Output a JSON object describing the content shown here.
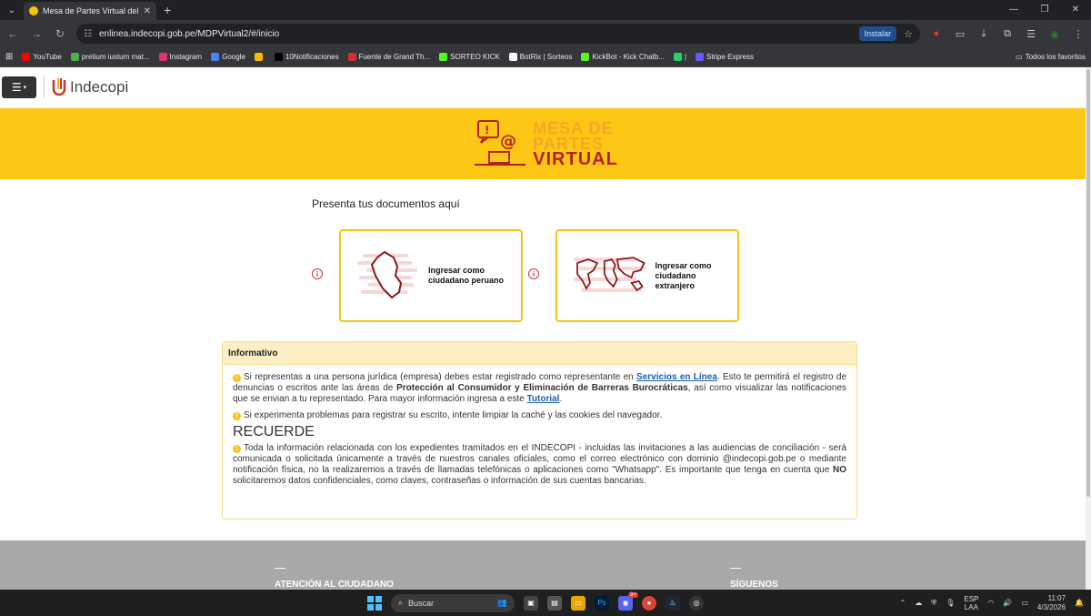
{
  "browser": {
    "tab_title": "Mesa de Partes Virtual del Inde",
    "url": "enlinea.indecopi.gob.pe/MDPVirtual2/#/inicio",
    "install_label": "Instalar",
    "bookmarks": [
      {
        "label": "YouTube",
        "color": "#ff0000"
      },
      {
        "label": "pretium iustum mat...",
        "color": "#4caf50"
      },
      {
        "label": "Instagram",
        "color": "#e1306c"
      },
      {
        "label": "Google",
        "color": "#4285f4"
      },
      {
        "label": "",
        "color": "#fbbc05"
      },
      {
        "label": "10Notificaciones",
        "color": "#000000"
      },
      {
        "label": "Fuente de Grand Th...",
        "color": "#d32f2f"
      },
      {
        "label": "SORTEO KICK",
        "color": "#53fc18"
      },
      {
        "label": "BotRix | Sorteos",
        "color": "#ffffff"
      },
      {
        "label": "KickBot - Kick Chatb...",
        "color": "#53fc18"
      },
      {
        "label": "|",
        "color": "#25d366"
      },
      {
        "label": "Stripe Express",
        "color": "#635bff"
      }
    ],
    "all_bookmarks_label": "Todos los favoritos"
  },
  "site": {
    "logo_text": "Indecopi",
    "banner": {
      "line1": "MESA DE",
      "line2": "PARTES",
      "line3": "VIRTUAL"
    },
    "presenta": "Presenta tus documentos aquí",
    "card_peru": {
      "line1": "Ingresar como",
      "line2": "ciudadano peruano"
    },
    "card_ext": {
      "line1": "Ingresar como",
      "line2": "ciudadano extranjero"
    },
    "informativo": {
      "title": "Informativo",
      "p1_a": "Si representas a una persona jurídica (empresa) debes estar registrado como representante en ",
      "p1_link1": "Servicios en Línea",
      "p1_b": ". Esto te permitirá el registro de denuncias o escritos ante las áreas de ",
      "p1_bold": "Protección al Consumidor y Eliminación de Barreras Burocráticas",
      "p1_c": ", así como visualizar las notificaciones que se envian a tu representado. Para mayor información ingresa a este ",
      "p1_link2": "Tutorial",
      "p1_d": ".",
      "p2": "Si experimenta problemas para registrar su escrito, intente limpiar la caché y las cookies del navegador.",
      "recuerde": "RECUERDE",
      "p3_a": "Toda la información relacionada con los expedientes tramitados en el INDECOPI - incluidas las invitaciones a las audiencias de conciliación - será comunicada o solicitada únicamente a través de nuestros canales oficiales, como el correo electrónico con dominio @indecopi.gob.pe o mediante notificación física, no la realizaremos a través de llamadas telefónicas o aplicaciones como \"Whatsapp\". Es importante que tenga en cuenta que ",
      "p3_bold": "NO",
      "p3_b": " solicitaremos datos confidenciales, como claves, contraseñas o información de sus cuentas bancarias."
    },
    "footer": {
      "col1": "ATENCIÓN AL CIUDADANO",
      "col2": "SÍGUENOS"
    }
  },
  "taskbar": {
    "search_label": "Buscar",
    "lang_1": "ESP",
    "lang_2": "LAA",
    "time": "11:07",
    "date": "4/3/2026",
    "discord_badge": "9+"
  },
  "colors": {
    "banner": "#fdc815",
    "accent_red": "#b5211c",
    "card_border": "#f5c518"
  }
}
